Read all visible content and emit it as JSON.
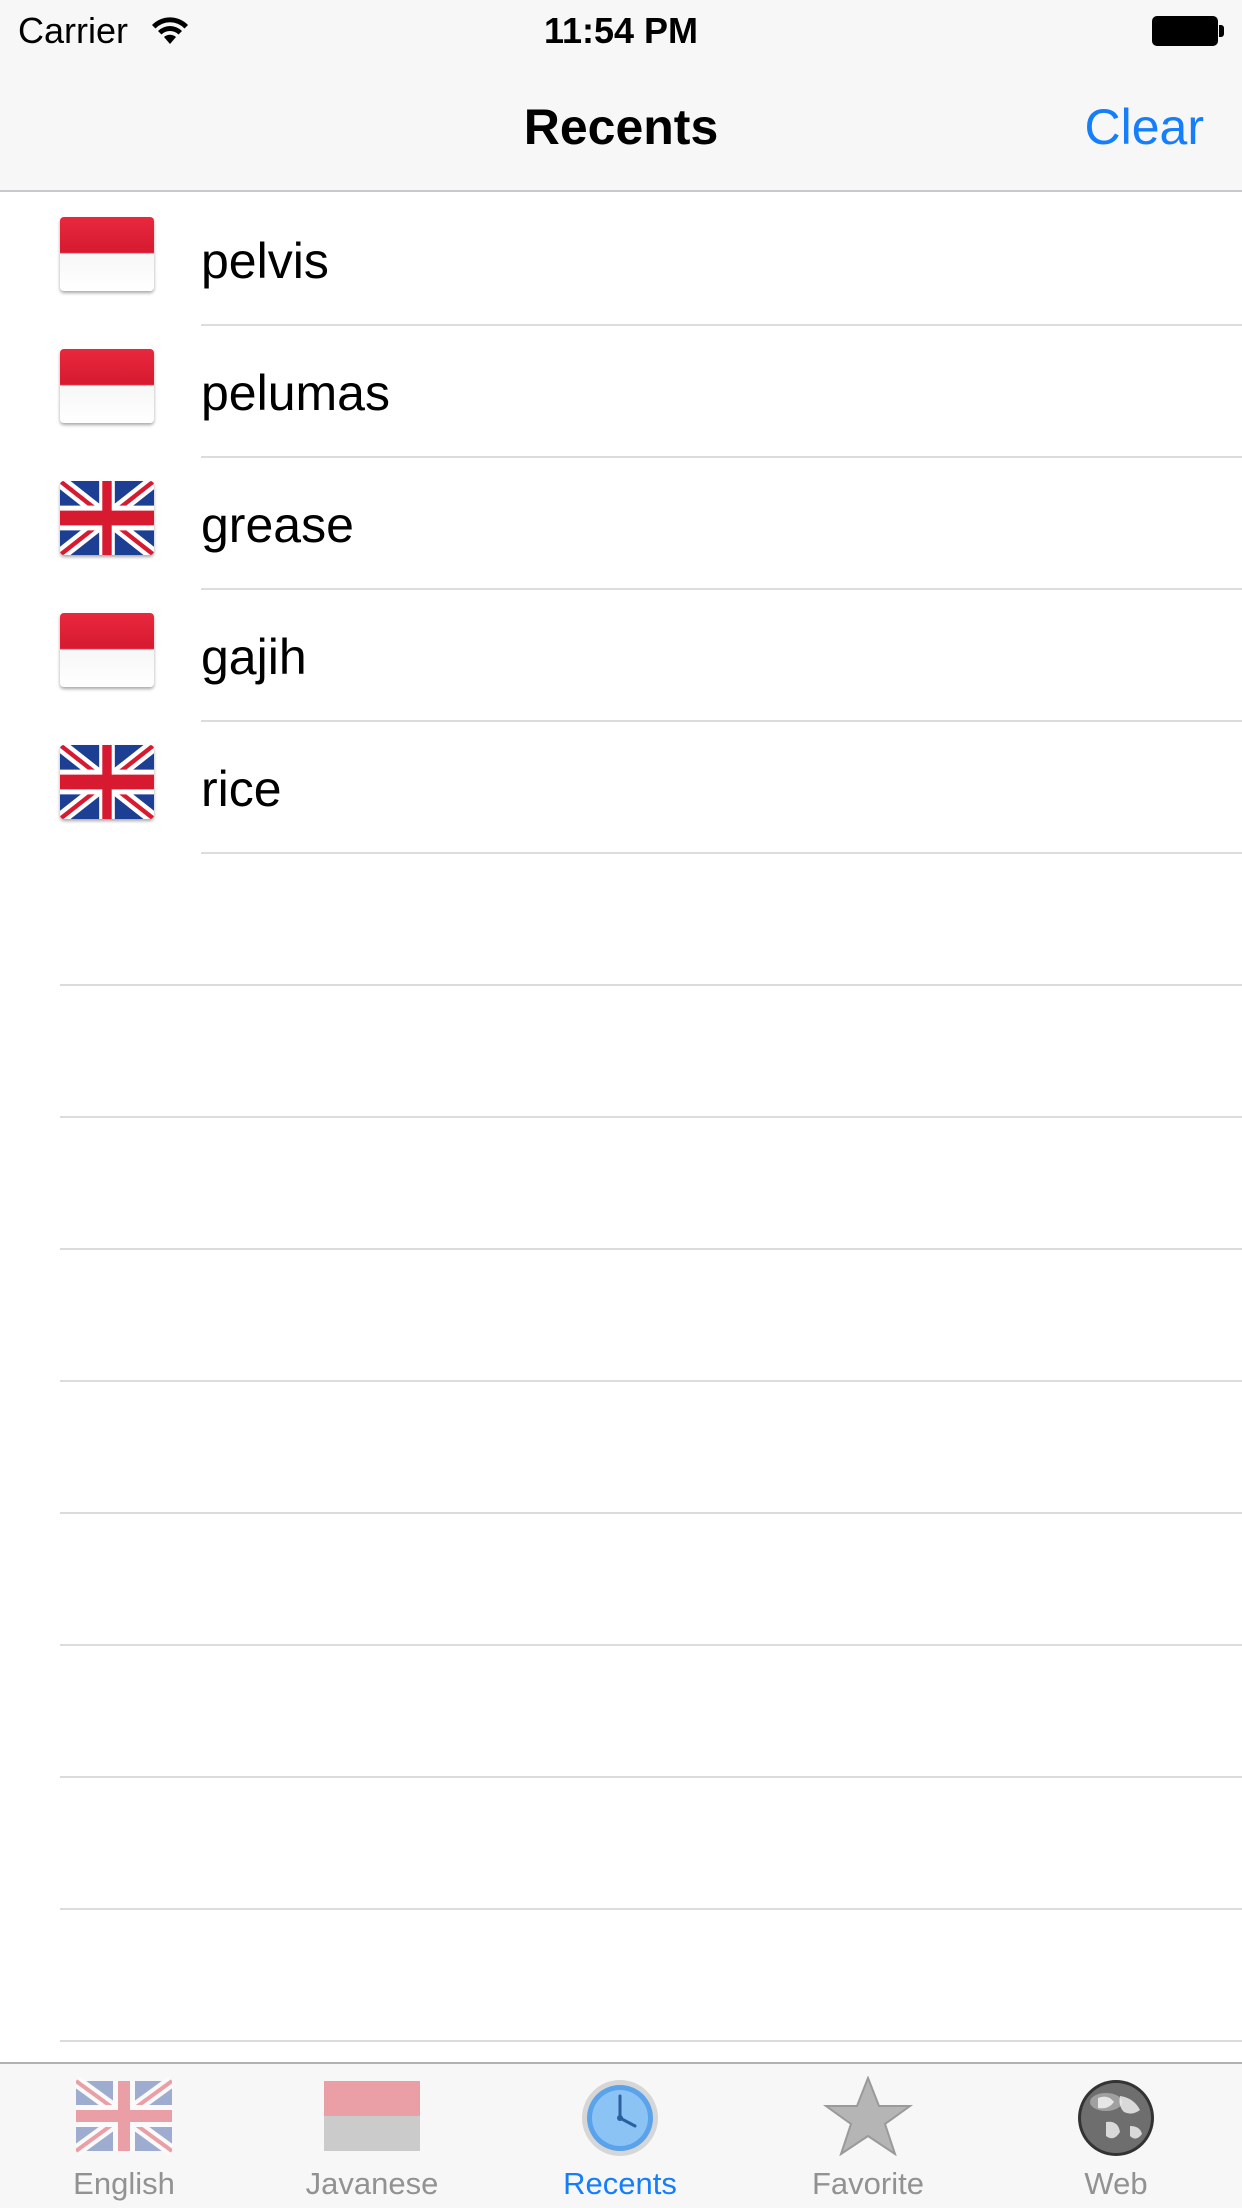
{
  "status_bar": {
    "carrier": "Carrier",
    "time": "11:54 PM"
  },
  "nav": {
    "title": "Recents",
    "clear_label": "Clear"
  },
  "recents": [
    {
      "word": "pelvis",
      "flag": "indonesia-flag-icon"
    },
    {
      "word": "pelumas",
      "flag": "indonesia-flag-icon"
    },
    {
      "word": "grease",
      "flag": "uk-flag-icon"
    },
    {
      "word": "gajih",
      "flag": "indonesia-flag-icon"
    },
    {
      "word": "rice",
      "flag": "uk-flag-icon"
    }
  ],
  "tabs": [
    {
      "label": "English",
      "icon": "uk-flag-icon",
      "active": false
    },
    {
      "label": "Javanese",
      "icon": "indonesia-flag-icon",
      "active": false
    },
    {
      "label": "Recents",
      "icon": "clock-icon",
      "active": true
    },
    {
      "label": "Favorite",
      "icon": "star-icon",
      "active": false
    },
    {
      "label": "Web",
      "icon": "globe-icon",
      "active": false
    }
  ],
  "colors": {
    "accent": "#157efb",
    "flag_red": "#d71a30",
    "uk_blue": "#1c3f94",
    "tab_inactive": "#929292"
  }
}
